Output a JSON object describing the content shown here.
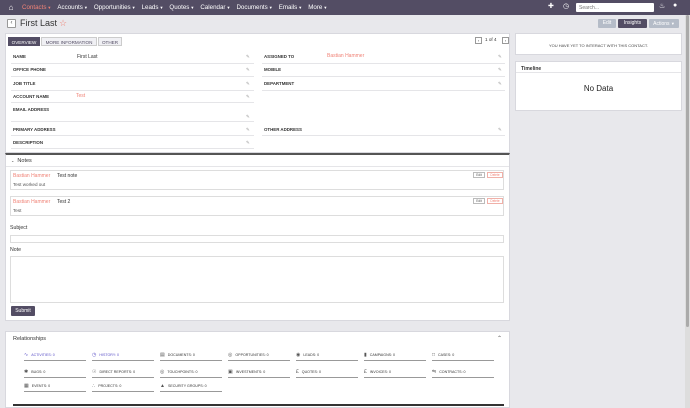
{
  "nav": {
    "items": [
      {
        "label": "Contacts",
        "active": true
      },
      {
        "label": "Accounts"
      },
      {
        "label": "Opportunities"
      },
      {
        "label": "Leads"
      },
      {
        "label": "Quotes"
      },
      {
        "label": "Calendar"
      },
      {
        "label": "Documents"
      },
      {
        "label": "Emails"
      },
      {
        "label": "More"
      }
    ],
    "search_placeholder": "Search...",
    "icons": [
      "home-icon",
      "plus-icon",
      "history-icon",
      "bell-icon",
      "user-icon"
    ]
  },
  "header": {
    "title": "First Last",
    "edit_label": "Edit",
    "insights_label": "Insights",
    "actions_label": "Actions"
  },
  "tabs": [
    "OVERVIEW",
    "MORE INFORMATION",
    "OTHER"
  ],
  "pager": {
    "text": "1 of 4"
  },
  "fields": {
    "name": {
      "label": "NAME",
      "value": "First Last"
    },
    "assigned_to": {
      "label": "ASSIGNED TO",
      "value": "Bastian Hammer"
    },
    "office_phone": {
      "label": "OFFICE PHONE",
      "value": ""
    },
    "mobile": {
      "label": "MOBILE",
      "value": ""
    },
    "job_title": {
      "label": "JOB TITLE",
      "value": ""
    },
    "department": {
      "label": "DEPARTMENT",
      "value": ""
    },
    "account_name": {
      "label": "ACCOUNT NAME",
      "value": "Test"
    },
    "email_address": {
      "label": "EMAIL ADDRESS",
      "value": ""
    },
    "primary_address": {
      "label": "PRIMARY ADDRESS",
      "value": ""
    },
    "other_address": {
      "label": "OTHER ADDRESS",
      "value": ""
    },
    "description": {
      "label": "DESCRIPTION",
      "value": ""
    }
  },
  "insights_message": "YOU HAVE YET TO INTERACT WITH THIS CONTACT.",
  "timeline": {
    "title": "Timeline",
    "empty": "No Data"
  },
  "notes": {
    "title": "Notes",
    "items": [
      {
        "author": "Bastian Hammer",
        "title": "Test note",
        "body": "Test worked out",
        "edit": "Edit",
        "delete": "Delete"
      },
      {
        "author": "Bastian Hammer",
        "title": "Test 2",
        "body": "Test",
        "edit": "Edit",
        "delete": "Delete"
      }
    ],
    "subject_label": "Subject",
    "note_label": "Note",
    "submit_label": "Submit"
  },
  "relationships": {
    "title": "Relationships",
    "items": [
      {
        "label": "ACTIVITIES: 0",
        "icon": "activity-icon",
        "highlight": true
      },
      {
        "label": "HISTORY: 0",
        "icon": "history-icon",
        "highlight": true
      },
      {
        "label": "DOCUMENTS: 0",
        "icon": "documents-icon"
      },
      {
        "label": "OPPORTUNITIES: 0",
        "icon": "opportunities-icon"
      },
      {
        "label": "LEADS: 0",
        "icon": "leads-icon"
      },
      {
        "label": "CAMPAIGNS: 0",
        "icon": "campaigns-icon"
      },
      {
        "label": "CASES: 0",
        "icon": "cases-icon"
      },
      {
        "label": "BUGS: 0",
        "icon": "bugs-icon"
      },
      {
        "label": "DIRECT REPORTS: 0",
        "icon": "direct-reports-icon"
      },
      {
        "label": "TOUCHPOINTS: 0",
        "icon": "touchpoints-icon"
      },
      {
        "label": "INVESTMENTS: 0",
        "icon": "investments-icon"
      },
      {
        "label": "QUOTES: 0",
        "icon": "quotes-icon"
      },
      {
        "label": "INVOICES: 0",
        "icon": "invoices-icon"
      },
      {
        "label": "CONTRACTS: 0",
        "icon": "contracts-icon"
      },
      {
        "label": "EVENTS: 0",
        "icon": "events-icon"
      },
      {
        "label": "PROJECTS: 0",
        "icon": "projects-icon"
      },
      {
        "label": "SECURITY GROUPS: 0",
        "icon": "security-groups-icon"
      }
    ]
  },
  "colors": {
    "brand": "#534d64",
    "accent": "#f08377",
    "highlight": "#5a4fc7"
  }
}
